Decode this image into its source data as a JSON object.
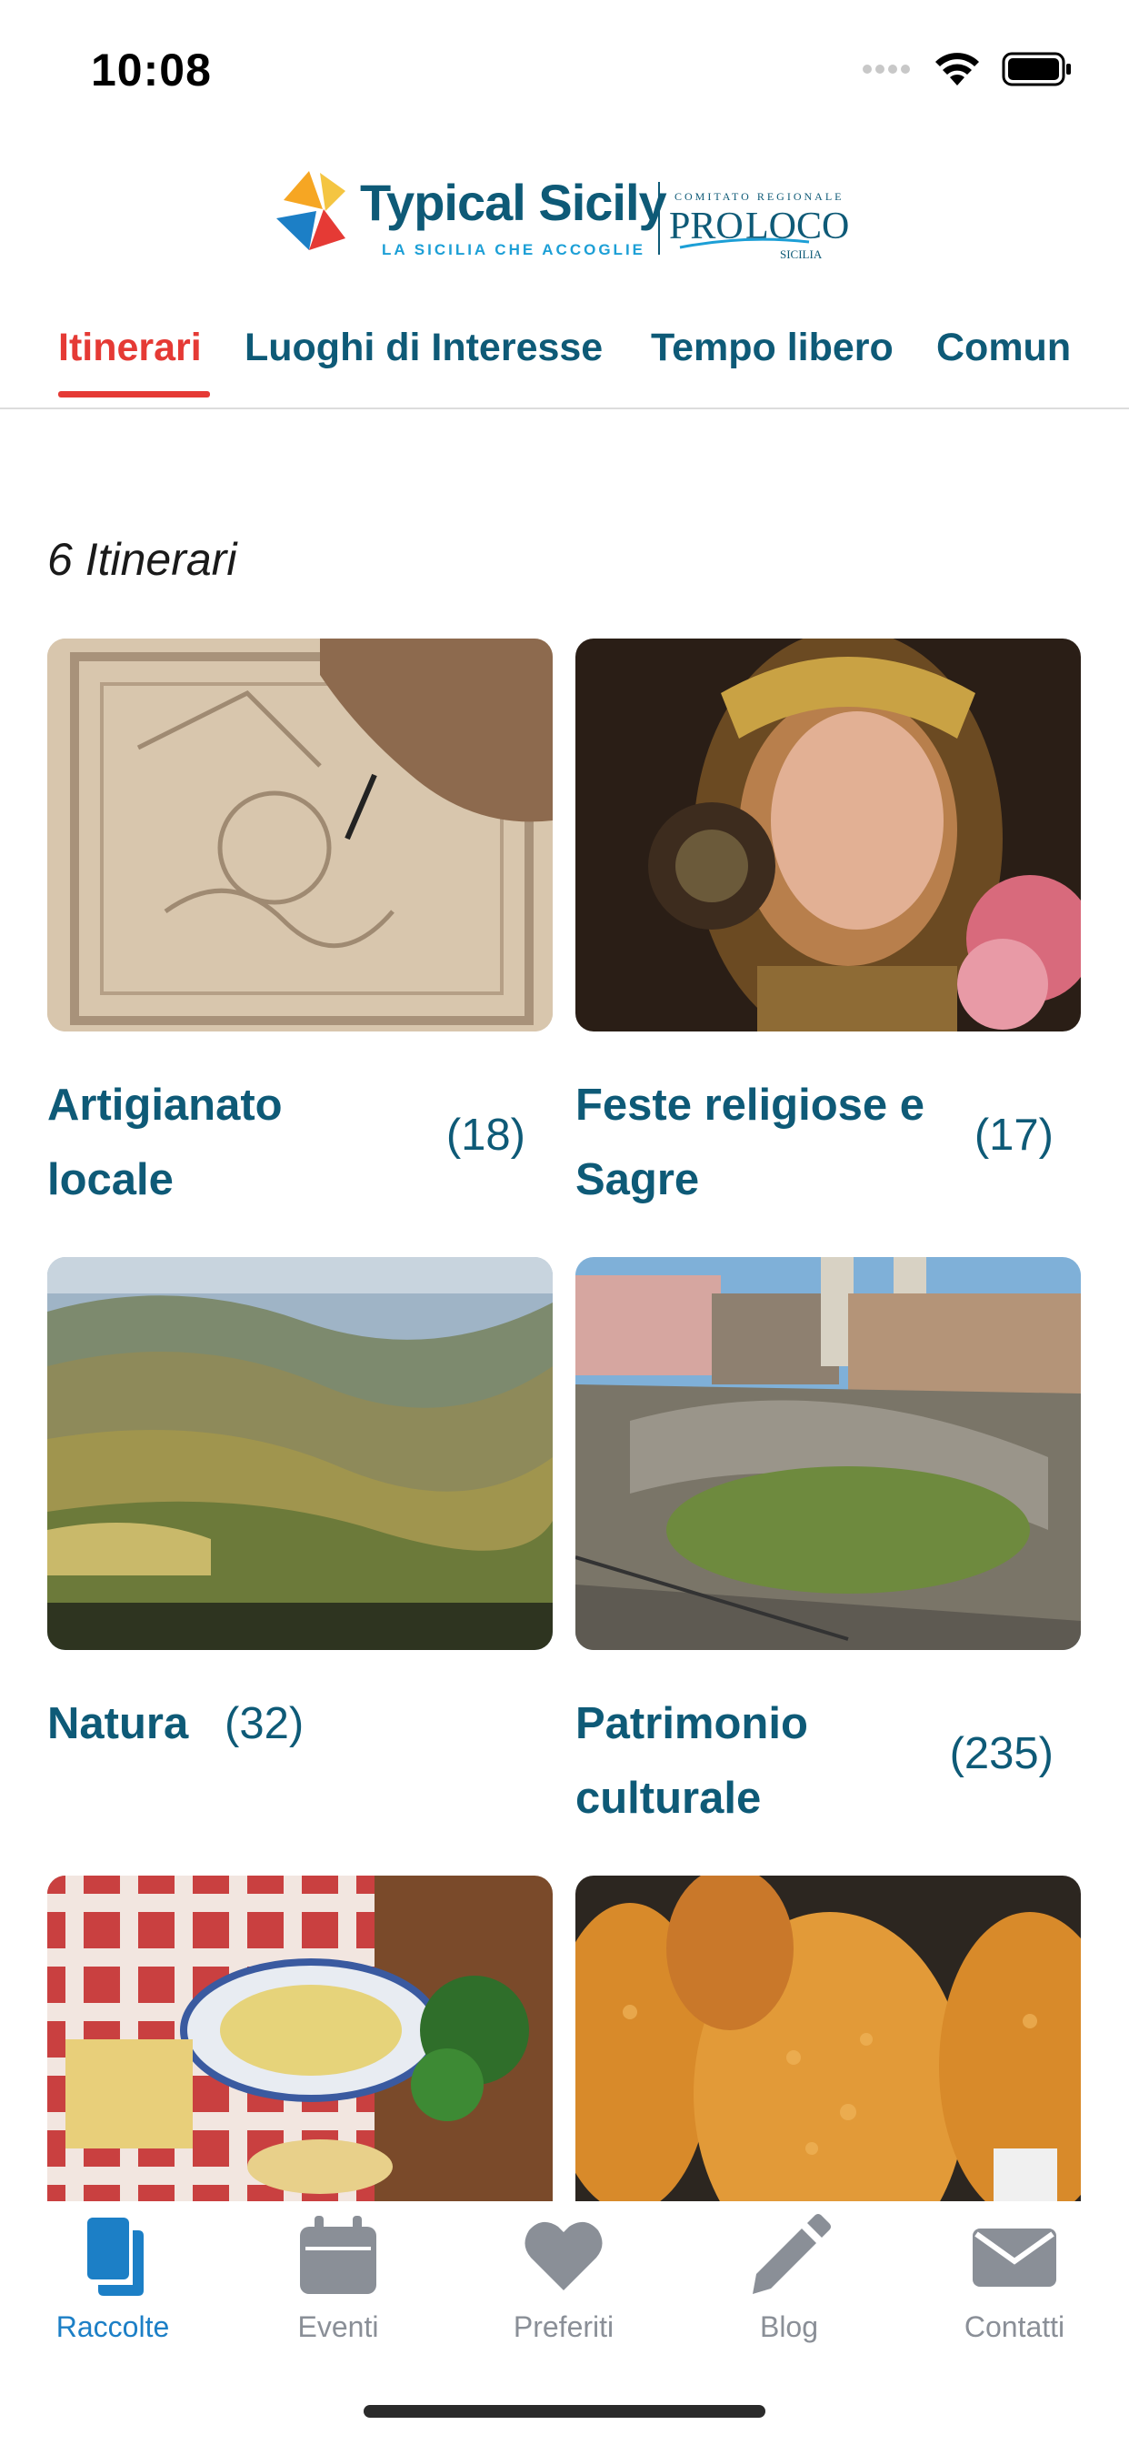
{
  "status": {
    "time": "10:08"
  },
  "header": {
    "logo_main": "Typical Sicily",
    "logo_sub": "LA SICILIA CHE ACCOGLIE",
    "partner_top": "COMITATO REGIONALE",
    "partner_main": "PRO LOCO",
    "partner_sub": "SICILIA"
  },
  "tabs": [
    {
      "label": "Itinerari",
      "active": true
    },
    {
      "label": "Luoghi di Interesse",
      "active": false
    },
    {
      "label": "Tempo libero",
      "active": false
    },
    {
      "label": "Comun",
      "active": false
    }
  ],
  "main": {
    "count_title": "6 Itinerari",
    "cards": [
      {
        "title_line1": "Artigianato",
        "title_line2": "locale",
        "count": "(18)",
        "image": "wood-carving-photo"
      },
      {
        "title_line1": "Feste religiose e",
        "title_line2": "Sagre",
        "count": "(17)",
        "image": "religious-statue-photo"
      },
      {
        "title_line1": "Natura",
        "title_line2": "",
        "count": "(32)",
        "image": "hills-landscape-photo"
      },
      {
        "title_line1": "Patrimonio",
        "title_line2": "culturale",
        "count": "(235)",
        "image": "roman-theatre-photo"
      },
      {
        "title_line1": "",
        "title_line2": "",
        "count": "",
        "image": "pasta-dish-photo"
      },
      {
        "title_line1": "",
        "title_line2": "",
        "count": "",
        "image": "arancini-photo"
      }
    ]
  },
  "bottom_nav": [
    {
      "label": "Raccolte",
      "icon": "collections-icon",
      "active": true
    },
    {
      "label": "Eventi",
      "icon": "calendar-icon",
      "active": false
    },
    {
      "label": "Preferiti",
      "icon": "heart-icon",
      "active": false
    },
    {
      "label": "Blog",
      "icon": "pencil-icon",
      "active": false
    },
    {
      "label": "Contatti",
      "icon": "envelope-icon",
      "active": false
    }
  ],
  "colors": {
    "brand_blue": "#0e5a77",
    "active_tab": "#e53a35",
    "nav_active": "#1c7fc6",
    "nav_inactive": "#8a8f97"
  }
}
